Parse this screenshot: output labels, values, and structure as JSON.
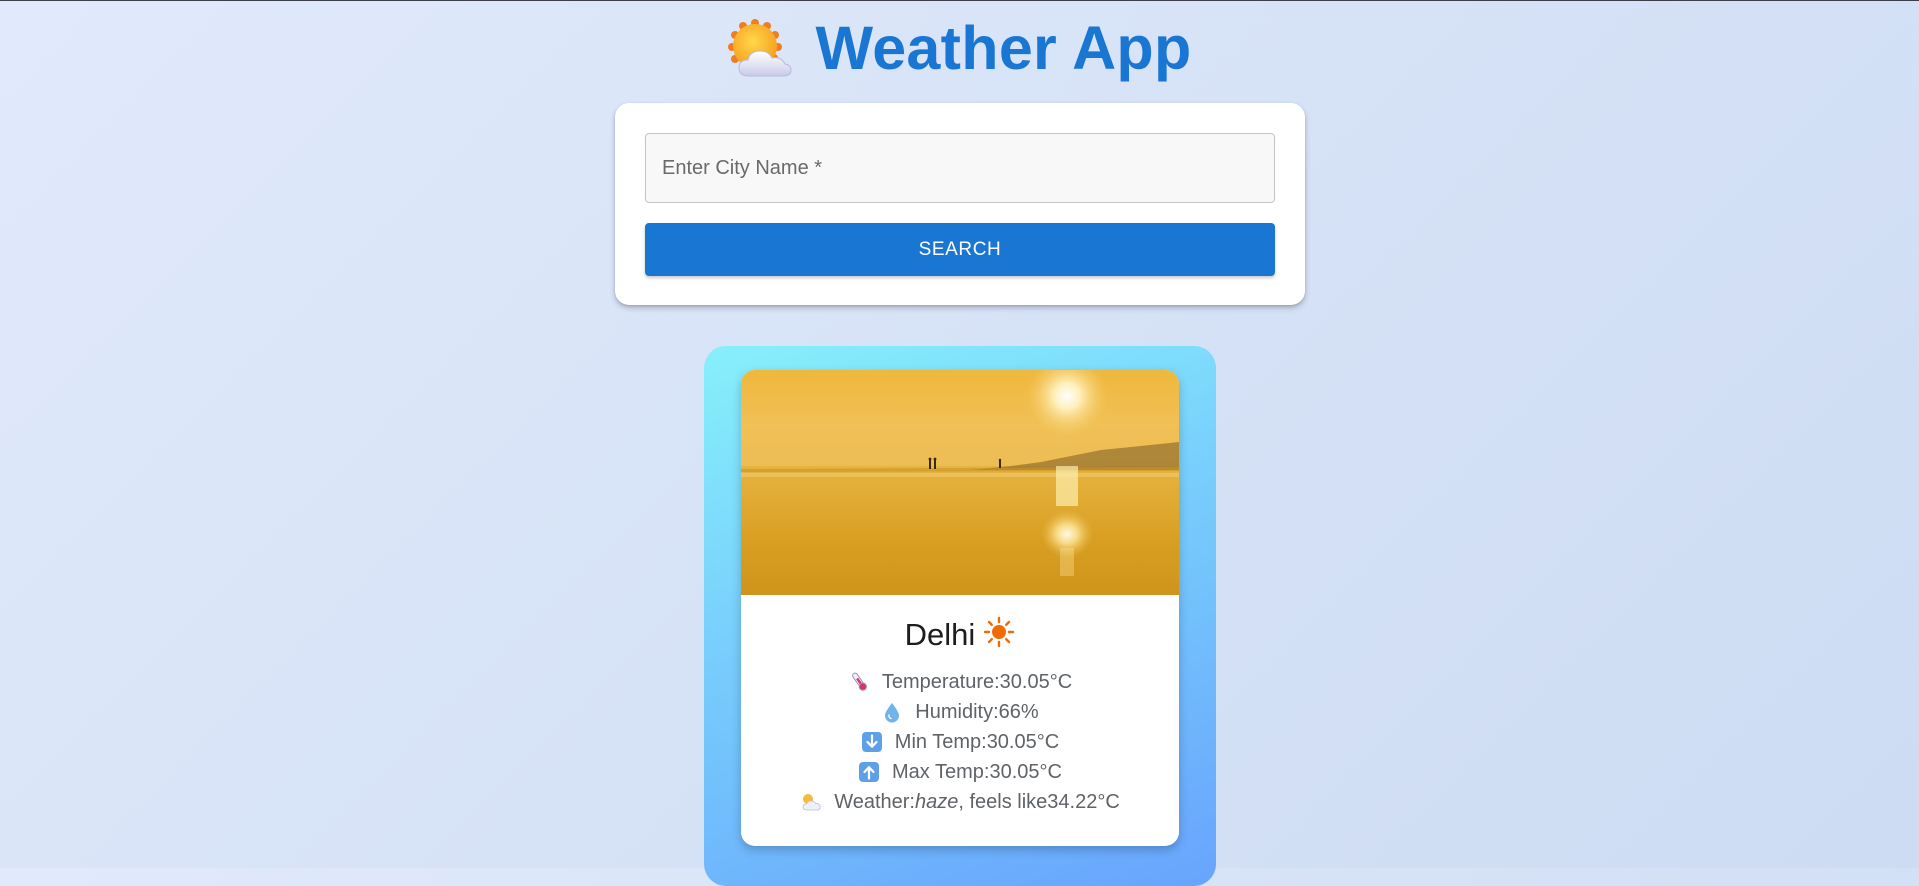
{
  "header": {
    "icon": "sun-behind-cloud-icon",
    "title": "Weather App"
  },
  "search": {
    "placeholder": "Enter City Name *",
    "value": "",
    "button_label": "SEARCH"
  },
  "result": {
    "image": "hazy-sunset-beach-photo",
    "city": "Delhi",
    "condition_icon": "sun-icon",
    "temperature": {
      "label": "Temperature: ",
      "value": "30.05°C",
      "icon": "thermometer-icon"
    },
    "humidity": {
      "label": "Humidity: ",
      "value": "66%",
      "icon": "droplet-icon"
    },
    "min_temp": {
      "label": "Min Temp: ",
      "value": "30.05°C",
      "icon": "down-arrow-icon"
    },
    "max_temp": {
      "label": "Max Temp: ",
      "value": "30.05°C",
      "icon": "up-arrow-icon"
    },
    "weather": {
      "label": "Weather: ",
      "description": "haze",
      "feels_like_label": ", feels like ",
      "feels_like": "34.22°C",
      "icon": "sun-behind-cloud-icon"
    }
  },
  "colors": {
    "accent": "#1976d2",
    "card_gradient_start": "#87f0fb",
    "card_gradient_end": "#68a4fd",
    "background": "#dce6f8"
  }
}
